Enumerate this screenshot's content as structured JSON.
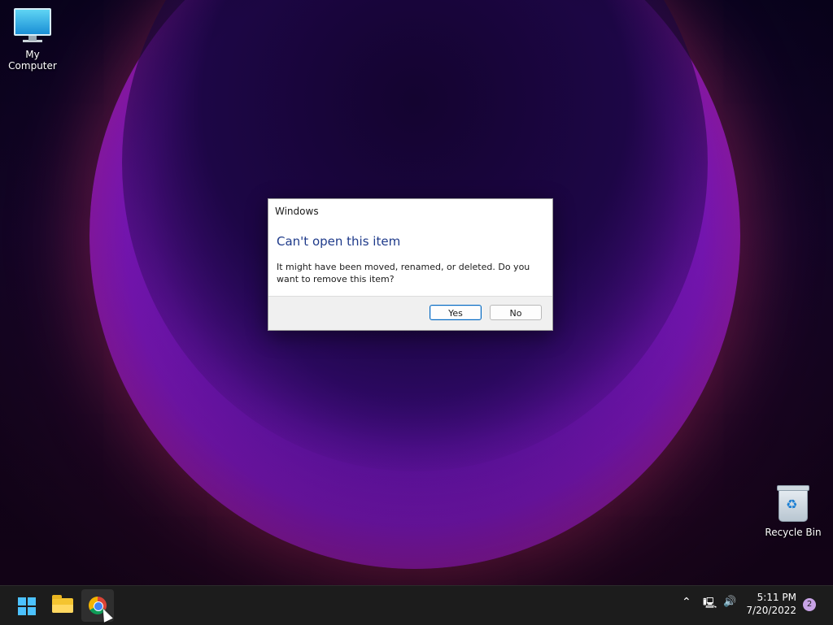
{
  "desktop": {
    "icons": [
      {
        "label": "My Computer",
        "icon": "my-computer-icon"
      },
      {
        "label": "Recycle Bin",
        "icon": "recycle-bin-icon"
      }
    ]
  },
  "dialog": {
    "title": "Windows",
    "heading": "Can't open this item",
    "message": "It might have been moved, renamed, or deleted. Do you want to remove this item?",
    "yes_label": "Yes",
    "no_label": "No"
  },
  "taskbar": {
    "apps": [
      {
        "name": "Start",
        "icon": "windows-start-icon"
      },
      {
        "name": "File Explorer",
        "icon": "file-explorer-icon"
      },
      {
        "name": "Google Chrome",
        "icon": "chrome-icon",
        "active": true
      }
    ],
    "tray": {
      "chevron_icon": "chevron-up-icon",
      "network_icon": "network-icon",
      "volume_icon": "volume-icon",
      "time": "5:11 PM",
      "date": "7/20/2022",
      "notifications_count": "2"
    }
  },
  "colors": {
    "accent": "#0067c0",
    "dialog_heading": "#1e3a8a",
    "taskbar": "#1c1c1c"
  }
}
